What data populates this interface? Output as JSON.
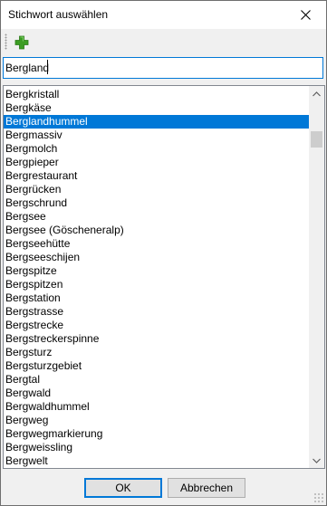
{
  "window": {
    "title": "Stichwort auswählen"
  },
  "toolbar": {
    "add_icon": "plus-icon",
    "add_color": "#3c9d23"
  },
  "search": {
    "value": "Bergland"
  },
  "list": {
    "items": [
      "Bergkristall",
      "Bergkäse",
      "Berglandhummel",
      "Bergmassiv",
      "Bergmolch",
      "Bergpieper",
      "Bergrestaurant",
      "Bergrücken",
      "Bergschrund",
      "Bergsee",
      "Bergsee (Göscheneralp)",
      "Bergseehütte",
      "Bergseeschijen",
      "Bergspitze",
      "Bergspitzen",
      "Bergstation",
      "Bergstrasse",
      "Bergstrecke",
      "Bergstreckerspinne",
      "Bergsturz",
      "Bergsturzgebiet",
      "Bergtal",
      "Bergwald",
      "Bergwaldhummel",
      "Bergweg",
      "Bergwegmarkierung",
      "Bergweissling",
      "Bergwelt"
    ],
    "selected_index": 2,
    "selection_color": "#0078d7"
  },
  "buttons": {
    "ok": "OK",
    "cancel": "Abbrechen"
  }
}
